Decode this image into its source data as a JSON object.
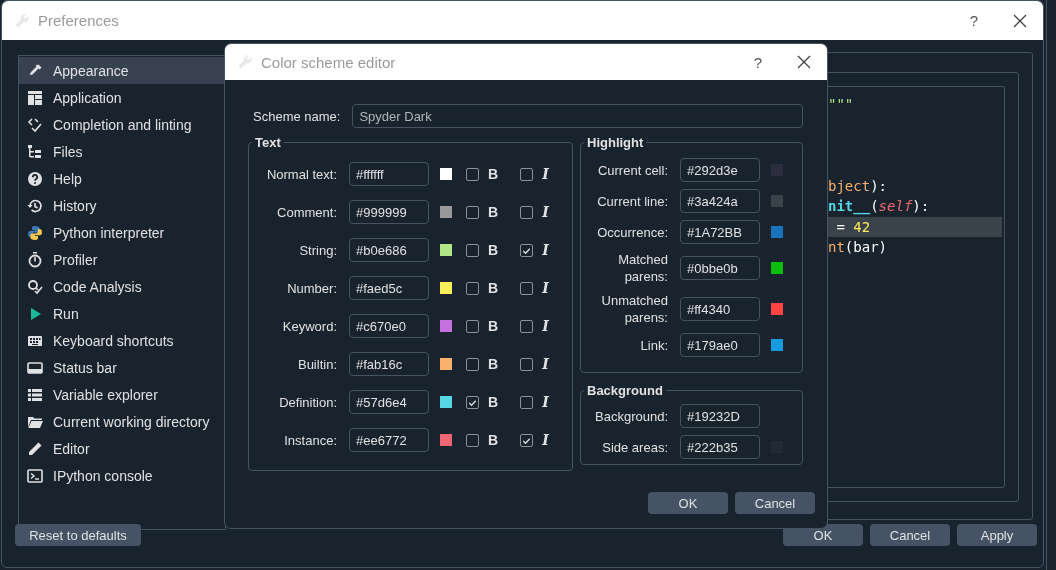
{
  "preferences": {
    "title": "Preferences",
    "help": "?",
    "sidebar": {
      "items": [
        {
          "label": "Appearance",
          "selected": true
        },
        {
          "label": "Application",
          "selected": false
        },
        {
          "label": "Completion and linting",
          "selected": false
        },
        {
          "label": "Files",
          "selected": false
        },
        {
          "label": "Help",
          "selected": false
        },
        {
          "label": "History",
          "selected": false
        },
        {
          "label": "Python interpreter",
          "selected": false
        },
        {
          "label": "Profiler",
          "selected": false
        },
        {
          "label": "Code Analysis",
          "selected": false
        },
        {
          "label": "Run",
          "selected": false
        },
        {
          "label": "Keyboard shortcuts",
          "selected": false
        },
        {
          "label": "Status bar",
          "selected": false
        },
        {
          "label": "Variable explorer",
          "selected": false
        },
        {
          "label": "Current working directory",
          "selected": false
        },
        {
          "label": "Editor",
          "selected": false
        },
        {
          "label": "IPython console",
          "selected": false
        }
      ]
    },
    "preview": {
      "lines": [
        {
          "current": false,
          "tokens": [
            {
              "text": "\"\"\"",
              "kind": "string"
            }
          ]
        },
        {
          "current": false,
          "tokens": [
            {
              "text": "bject",
              "kind": "builtin"
            },
            {
              "text": "):",
              "kind": "normal"
            }
          ]
        },
        {
          "current": false,
          "tokens": [
            {
              "text": "nit__",
              "kind": "definition"
            },
            {
              "text": "(",
              "kind": "normal"
            },
            {
              "text": "self",
              "kind": "instance"
            },
            {
              "text": "):",
              "kind": "normal"
            }
          ]
        },
        {
          "current": true,
          "tokens": [
            {
              "text": " = ",
              "kind": "normal"
            },
            {
              "text": "42",
              "kind": "number"
            }
          ]
        },
        {
          "current": false,
          "tokens": [
            {
              "text": "nt",
              "kind": "builtin"
            },
            {
              "text": "(bar)",
              "kind": "normal"
            }
          ]
        }
      ]
    },
    "reset_button": "Reset to defaults",
    "buttons": [
      "OK",
      "Cancel",
      "Apply"
    ]
  },
  "dialog": {
    "title": "Color scheme editor",
    "help": "?",
    "scheme_name": {
      "label": "Scheme name:",
      "value": "Spyder Dark"
    },
    "text_group": {
      "title": "Text",
      "rows": [
        {
          "label": "Normal text:",
          "value": "#ffffff",
          "color": "#ffffff",
          "bold": false,
          "bold_label": "B",
          "italic": false,
          "italic_label": "I"
        },
        {
          "label": "Comment:",
          "value": "#999999",
          "color": "#999999",
          "bold": false,
          "bold_label": "B",
          "italic": false,
          "italic_label": "I"
        },
        {
          "label": "String:",
          "value": "#b0e686",
          "color": "#b0e686",
          "bold": false,
          "bold_label": "B",
          "italic": true,
          "italic_label": "I"
        },
        {
          "label": "Number:",
          "value": "#faed5c",
          "color": "#faed5c",
          "bold": false,
          "bold_label": "B",
          "italic": false,
          "italic_label": "I"
        },
        {
          "label": "Keyword:",
          "value": "#c670e0",
          "color": "#c670e0",
          "bold": false,
          "bold_label": "B",
          "italic": false,
          "italic_label": "I"
        },
        {
          "label": "Builtin:",
          "value": "#fab16c",
          "color": "#fab16c",
          "bold": false,
          "bold_label": "B",
          "italic": false,
          "italic_label": "I"
        },
        {
          "label": "Definition:",
          "value": "#57d6e4",
          "color": "#57d6e4",
          "bold": true,
          "bold_label": "B",
          "italic": false,
          "italic_label": "I"
        },
        {
          "label": "Instance:",
          "value": "#ee6772",
          "color": "#ee6772",
          "bold": false,
          "bold_label": "B",
          "italic": true,
          "italic_label": "I"
        }
      ]
    },
    "highlight_group": {
      "title": "Highlight",
      "rows": [
        {
          "label": "Current cell:",
          "value": "#292d3e",
          "color": "#292d3e"
        },
        {
          "label": "Current line:",
          "value": "#3a424a",
          "color": "#3a424a"
        },
        {
          "label": "Occurrence:",
          "value": "#1A72BB",
          "color": "#1a72bb"
        },
        {
          "label": "Matched parens:",
          "value": "#0bbe0b",
          "color": "#0bbe0b"
        },
        {
          "label": "Unmatched parens:",
          "value": "#ff4340",
          "color": "#ff4340"
        },
        {
          "label": "Link:",
          "value": "#179ae0",
          "color": "#179ae0"
        }
      ]
    },
    "background_group": {
      "title": "Background",
      "rows": [
        {
          "label": "Background:",
          "value": "#19232D"
        },
        {
          "label": "Side areas:",
          "value": "#222b35",
          "color": "#222b35"
        }
      ]
    },
    "buttons": [
      "OK",
      "Cancel"
    ]
  }
}
